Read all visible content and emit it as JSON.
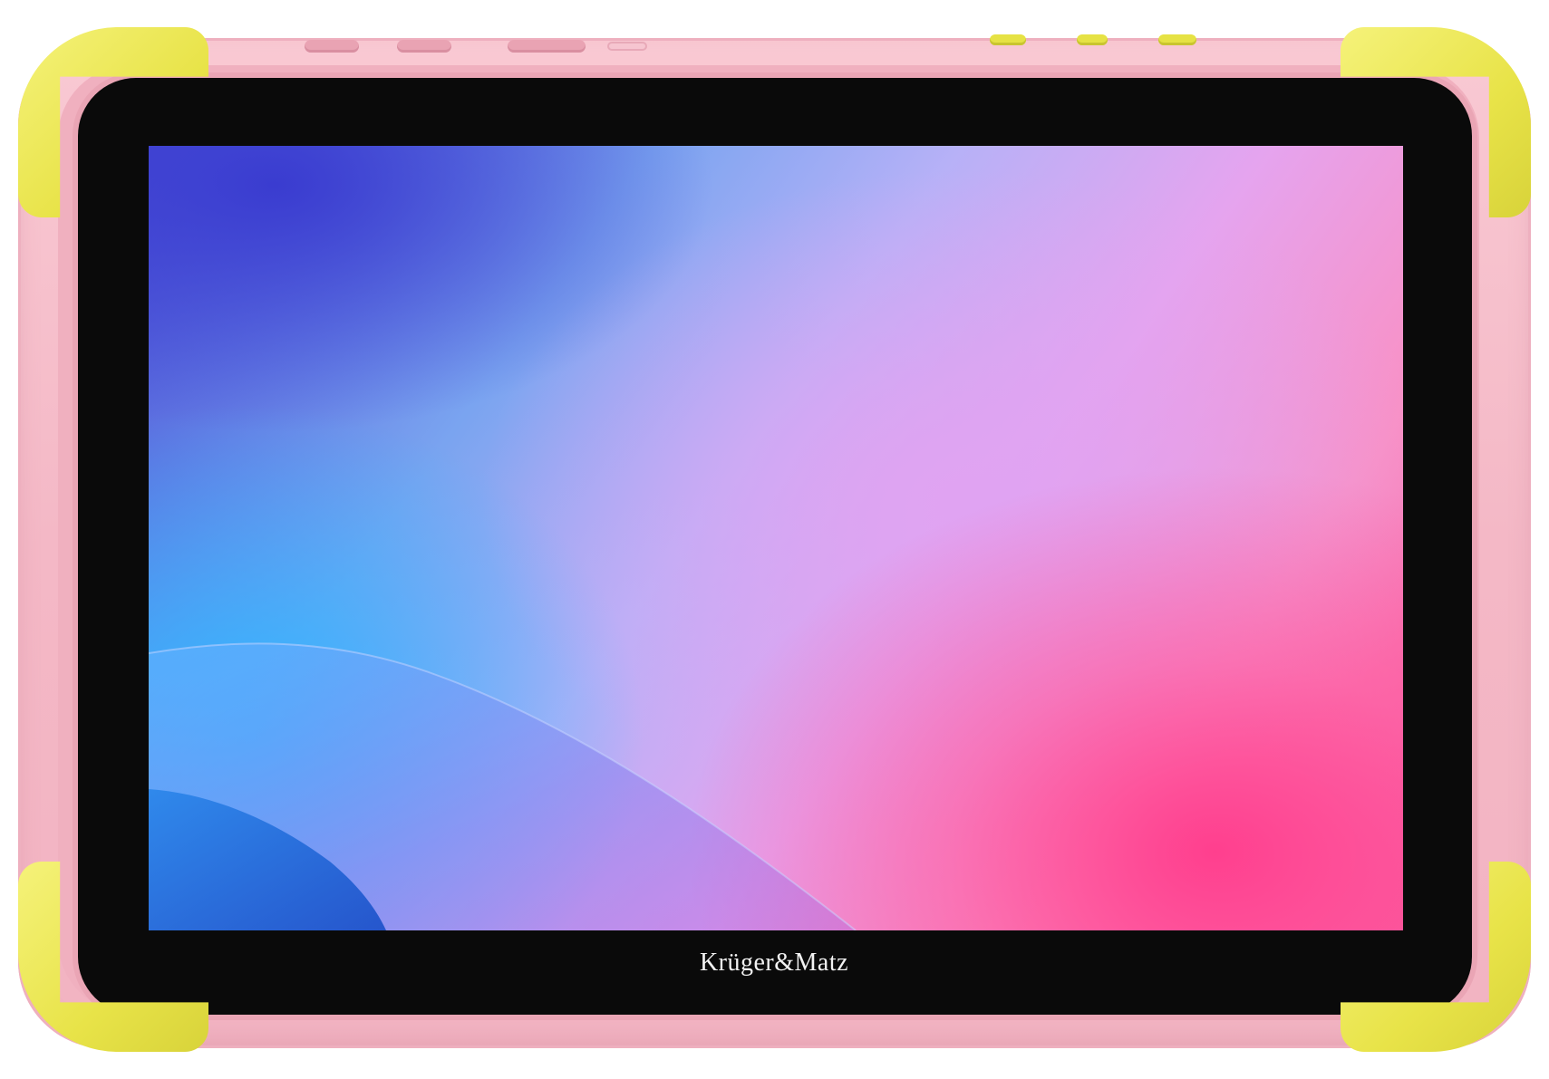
{
  "device": {
    "brand_label": "Krüger&Matz",
    "case_color": "#f4b8c6",
    "bumper_color": "#e8e348",
    "bezel_color": "#0a0a0a"
  },
  "wallpaper": {
    "colors": [
      "#4a4fd6",
      "#2fb4ff",
      "#b7b1f7",
      "#e5a4ef",
      "#f7559a"
    ]
  },
  "icons": {
    "top_buttons": [
      "button-icon",
      "button-icon",
      "button-icon"
    ],
    "side_buttons": [
      "button-icon",
      "button-icon",
      "button-icon"
    ]
  }
}
